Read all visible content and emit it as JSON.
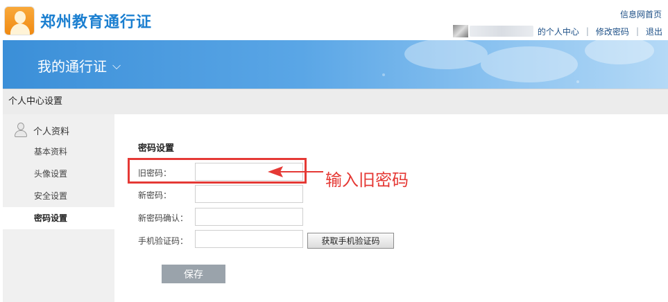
{
  "header": {
    "brand": "郑州教育通行证",
    "home_link": "信息网首页",
    "user_center": "的个人中心",
    "change_password": "修改密码",
    "logout": "退出"
  },
  "banner": {
    "title": "我的通行证"
  },
  "section": {
    "title": "个人中心设置"
  },
  "sidebar": {
    "group_label": "个人资料",
    "items": [
      {
        "label": "基本资料"
      },
      {
        "label": "头像设置"
      },
      {
        "label": "安全设置"
      },
      {
        "label": "密码设置"
      }
    ]
  },
  "form": {
    "title": "密码设置",
    "fields": [
      {
        "label": "旧密码：",
        "value": ""
      },
      {
        "label": "新密码：",
        "value": ""
      },
      {
        "label": "新密码确认：",
        "value": ""
      },
      {
        "label": "手机验证码：",
        "value": ""
      }
    ],
    "sms_button": "获取手机验证码",
    "save_button": "保存"
  },
  "annotation": {
    "text": "输入旧密码",
    "color": "#e53935"
  },
  "colors": {
    "brand": "#1b7fd0",
    "banner": "#3b8fd8",
    "link": "#1c4f86"
  }
}
